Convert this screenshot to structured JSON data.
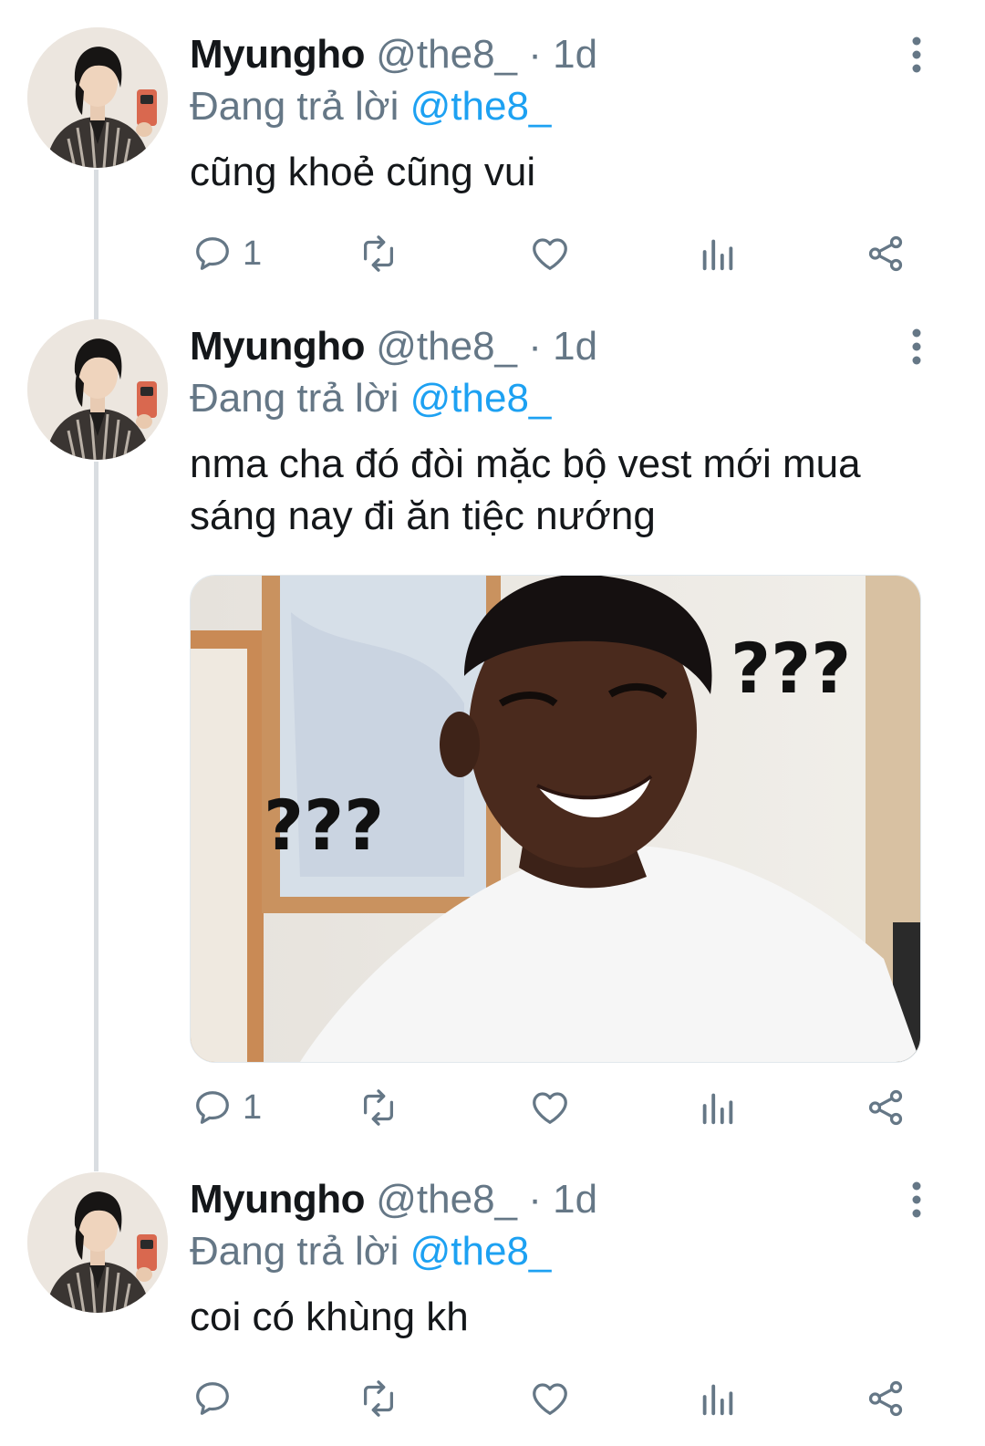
{
  "tweets": [
    {
      "name": "Myungho",
      "handle": "@the8_",
      "separator": "·",
      "time": "1d",
      "reply_prefix": "Đang trả lời",
      "reply_to": "@the8_",
      "text": "cũng khoẻ cũng vui",
      "reply_count": "1"
    },
    {
      "name": "Myungho",
      "handle": "@the8_",
      "separator": "·",
      "time": "1d",
      "reply_prefix": "Đang trả lời",
      "reply_to": "@the8_",
      "text": "nma cha đó đòi mặc bộ vest mới mua sáng nay đi ăn tiệc nướng",
      "media": {
        "overlay_left": "???",
        "overlay_right": "???"
      },
      "reply_count": "1"
    },
    {
      "name": "Myungho",
      "handle": "@the8_",
      "separator": "·",
      "time": "1d",
      "reply_prefix": "Đang trả lời",
      "reply_to": "@the8_",
      "text": "coi có khùng kh",
      "reply_count": ""
    }
  ],
  "icons": {
    "reply": "speech-bubble-icon",
    "retweet": "retweet-icon",
    "like": "heart-icon",
    "analytics": "bar-chart-icon",
    "share": "share-icon",
    "more": "vertical-dots-icon"
  },
  "colors": {
    "text": "#14171a",
    "secondary": "#657786",
    "link": "#1da1f2",
    "thread_line": "#d9dde1"
  }
}
